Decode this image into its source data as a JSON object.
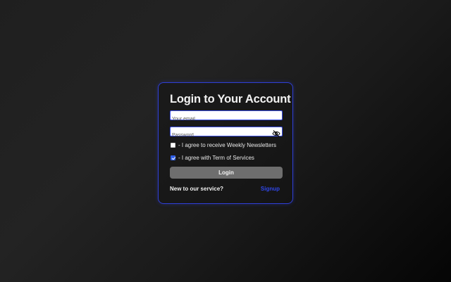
{
  "login_form": {
    "title": "Login to Your Account",
    "email": {
      "value": "",
      "placeholder": "Your email"
    },
    "password": {
      "value": "",
      "placeholder": "Password"
    },
    "password_toggle_icon": "eye-slash-icon",
    "newsletter": {
      "label": "- I agree to receive Weekly Newsletters",
      "checked": false
    },
    "terms": {
      "label": "- I agree with Term of Services",
      "checked": true
    },
    "login_label": "Login",
    "new_to_service": "New to our service?",
    "signup_label": "Signup"
  },
  "colors": {
    "accent": "#2f46e6",
    "card_border": "#2f3fd6",
    "button_bg": "#6e6e6e",
    "background_dark": "#050505",
    "background_light": "#232323"
  }
}
